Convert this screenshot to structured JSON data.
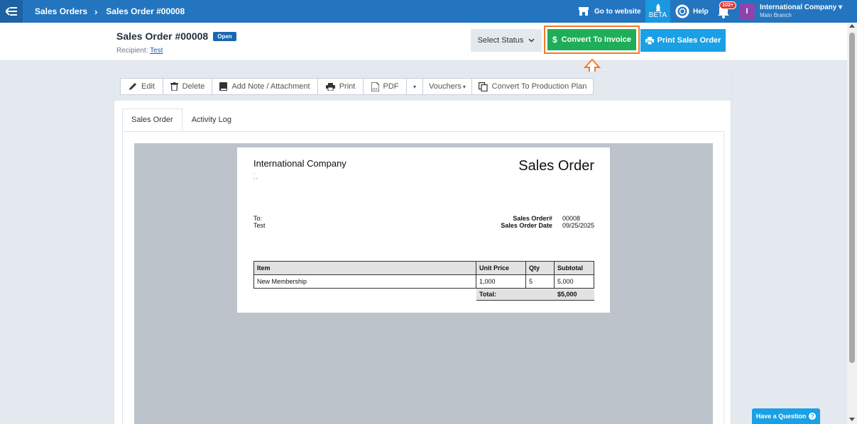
{
  "topbar": {
    "breadcrumbs": [
      "Sales Orders",
      "Sales Order #00008"
    ],
    "goto_website": "Go to website",
    "beta": "BETA",
    "help": "Help",
    "notifications_count": "102+",
    "avatar_initial": "I",
    "company_name": "International Company",
    "branch_name": "Main Branch"
  },
  "header": {
    "title": "Sales Order #00008",
    "status": "Open",
    "recipient_label": "Recipient:",
    "recipient_name": "Test",
    "select_status": "Select Status",
    "convert_to_invoice": "Convert To Invoice",
    "print_sales_order": "Print Sales Order"
  },
  "toolbar": {
    "edit": "Edit",
    "delete": "Delete",
    "add_note": "Add Note / Attachment",
    "print": "Print",
    "pdf": "PDF",
    "vouchers": "Vouchers",
    "convert_production": "Convert To Production Plan"
  },
  "tabs": [
    "Sales Order",
    "Activity Log"
  ],
  "document": {
    "company": "International Company",
    "address_line1": ".",
    "address_line2": ", ,",
    "title": "Sales Order",
    "to_label": "To:",
    "to_name": "Test",
    "order_no_label": "Sales Order#",
    "order_no": "00008",
    "order_date_label": "Sales Order Date",
    "order_date": "09/25/2025",
    "columns": [
      "Item",
      "Unit Price",
      "Qty",
      "Subtotal"
    ],
    "rows": [
      {
        "item": "New Membership",
        "unit_price": "1,000",
        "qty": "5",
        "subtotal": "5,000"
      }
    ],
    "total_label": "Total:",
    "total_value": "$5,000"
  },
  "have_question": "Have a Question"
}
